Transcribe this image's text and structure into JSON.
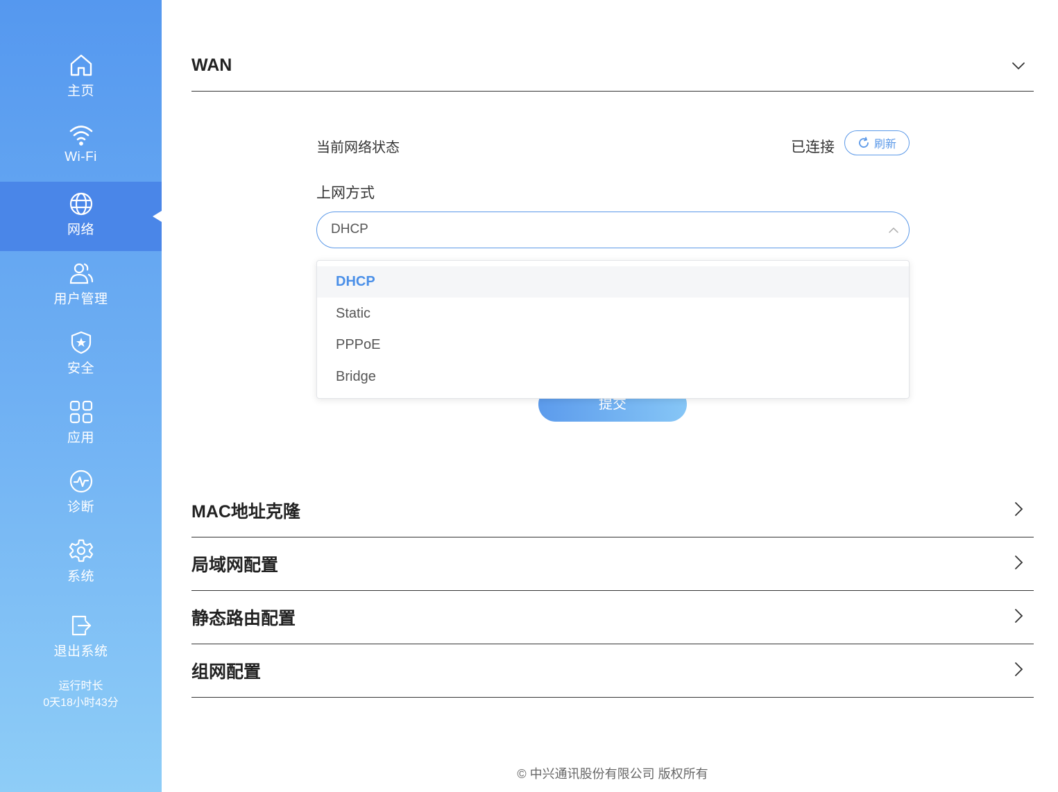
{
  "sidebar": {
    "items": [
      {
        "label": "主页",
        "icon": "home-icon"
      },
      {
        "label": "Wi-Fi",
        "icon": "wifi-icon"
      },
      {
        "label": "网络",
        "icon": "globe-icon",
        "active": true
      },
      {
        "label": "用户管理",
        "icon": "users-icon"
      },
      {
        "label": "安全",
        "icon": "shield-star-icon"
      },
      {
        "label": "应用",
        "icon": "apps-grid-icon"
      },
      {
        "label": "诊断",
        "icon": "pulse-icon"
      },
      {
        "label": "系统",
        "icon": "gear-icon"
      },
      {
        "label": "退出系统",
        "icon": "logout-icon"
      }
    ],
    "uptime_label": "运行时长",
    "uptime_value": "0天18小时43分"
  },
  "wan": {
    "title": "WAN",
    "status_label": "当前网络状态",
    "status_value": "已连接",
    "refresh_label": "刷新",
    "mode_label": "上网方式",
    "mode_selected": "DHCP",
    "mode_options": [
      "DHCP",
      "Static",
      "PPPoE",
      "Bridge"
    ],
    "submit_label": "提交"
  },
  "sections": [
    {
      "title": "MAC地址克隆"
    },
    {
      "title": "局域网配置"
    },
    {
      "title": "静态路由配置"
    },
    {
      "title": "组网配置"
    }
  ],
  "footer": {
    "text": "© 中兴通讯股份有限公司 版权所有"
  },
  "colors": {
    "accent": "#5a98e8",
    "sidebar_top": "#5598ef",
    "sidebar_bottom": "#8ecdf7",
    "active_item": "#4a86e8"
  }
}
